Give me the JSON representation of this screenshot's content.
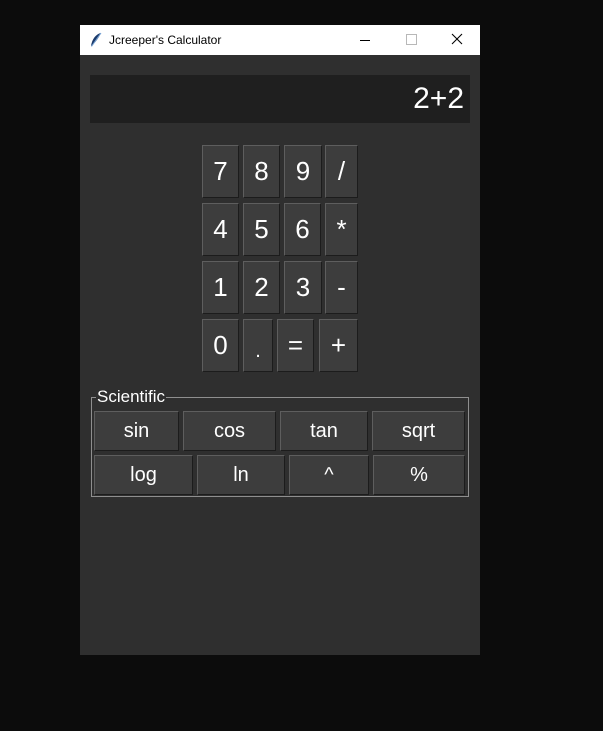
{
  "window": {
    "title": "Jcreeper's Calculator",
    "icon": "feather-icon",
    "controls": [
      "minimize-icon",
      "maximize-icon",
      "close-icon"
    ]
  },
  "display": {
    "text": "2+2"
  },
  "keypad": {
    "rows": [
      [
        "7",
        "8",
        "9",
        "/"
      ],
      [
        "4",
        "5",
        "6",
        "*"
      ],
      [
        "1",
        "2",
        "3",
        "-"
      ],
      [
        "0",
        ".",
        "=",
        "+"
      ]
    ]
  },
  "scientific": {
    "label": "Scientific",
    "rows": [
      [
        "sin",
        "cos",
        "tan",
        "sqrt"
      ],
      [
        "log",
        "ln",
        "^",
        "%"
      ]
    ]
  },
  "colors": {
    "desktop": "#0c0c0c",
    "window_bg": "#2f2f2f",
    "display_bg": "#1f1f1f",
    "button_bg": "#3d3d3d",
    "text": "#ffffff"
  }
}
